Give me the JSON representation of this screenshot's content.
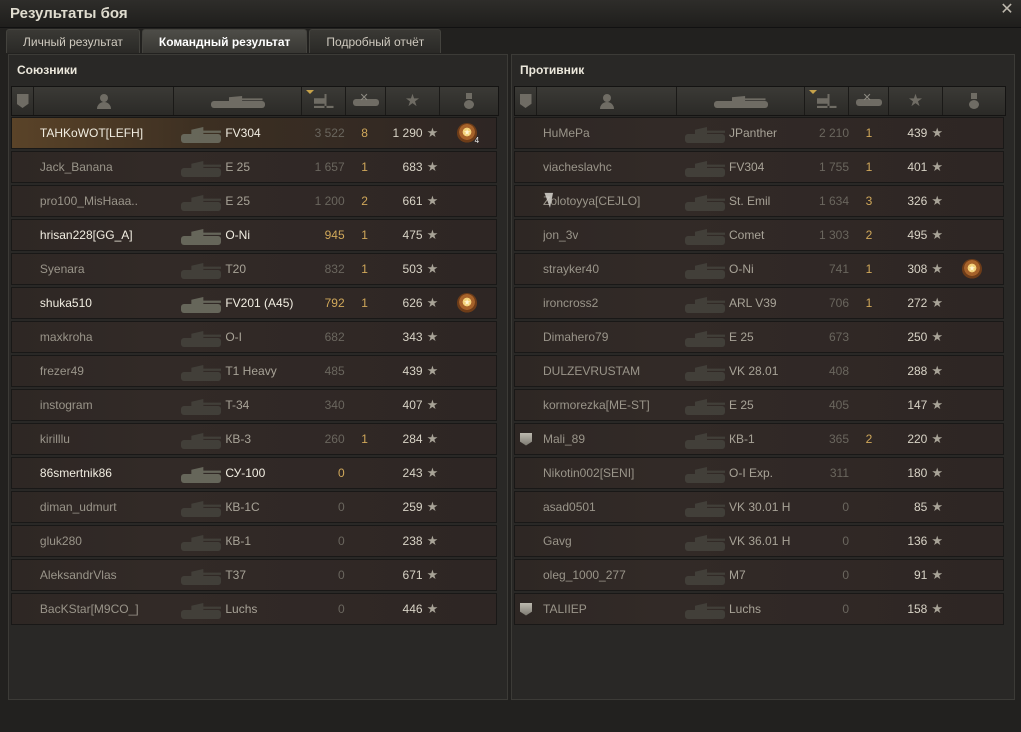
{
  "window": {
    "title": "Результаты боя",
    "close_icon": "close-icon"
  },
  "tabs": [
    {
      "label": "Личный результат",
      "active": false
    },
    {
      "label": "Командный результат",
      "active": true
    },
    {
      "label": "Подробный отчёт",
      "active": false
    }
  ],
  "allies": {
    "title": "Союзники",
    "columns": [
      "platoon-icon",
      "player-icon",
      "vehicle-icon",
      "damage-icon",
      "frags-icon",
      "xp-star-icon",
      "medal-icon"
    ],
    "sorted_column": "damage-icon",
    "rows": [
      {
        "name": "TAHKoWOT[LEFH]",
        "tank": "FV304",
        "damage": "3 522",
        "frags": "8",
        "xp": "1 290",
        "medal": true,
        "medal_count": "4",
        "self": true,
        "hi": true
      },
      {
        "name": "Jack_Banana",
        "tank": "E 25",
        "damage": "1 657",
        "frags": "1",
        "xp": "683"
      },
      {
        "name": "pro100_MisHaaa..",
        "tank": "E 25",
        "damage": "1 200",
        "frags": "2",
        "xp": "661"
      },
      {
        "name": "hrisan228[GG_A]",
        "tank": "O-Ni",
        "damage": "945",
        "frags": "1",
        "xp": "475",
        "hi": true,
        "gold": true
      },
      {
        "name": "Syenara",
        "tank": "T20",
        "damage": "832",
        "frags": "1",
        "xp": "503"
      },
      {
        "name": "shuka510",
        "tank": "FV201 (A45)",
        "damage": "792",
        "frags": "1",
        "xp": "626",
        "medal": true,
        "hi": true,
        "gold": true
      },
      {
        "name": "maxkroha",
        "tank": "O-I",
        "damage": "682",
        "frags": "",
        "xp": "343"
      },
      {
        "name": "frezer49",
        "tank": "T1 Heavy",
        "damage": "485",
        "frags": "",
        "xp": "439"
      },
      {
        "name": "instogram",
        "tank": "T-34",
        "damage": "340",
        "frags": "",
        "xp": "407"
      },
      {
        "name": "kirilllu",
        "tank": "КВ-3",
        "damage": "260",
        "frags": "1",
        "xp": "284"
      },
      {
        "name": "86smertnik86",
        "tank": "СУ-100",
        "damage": "0",
        "frags": "",
        "xp": "243",
        "hi": true,
        "gold": true
      },
      {
        "name": "diman_udmurt",
        "tank": "КВ-1С",
        "damage": "0",
        "frags": "",
        "xp": "259"
      },
      {
        "name": "gluk280",
        "tank": "КВ-1",
        "damage": "0",
        "frags": "",
        "xp": "238"
      },
      {
        "name": "AleksandrVlas",
        "tank": "T37",
        "damage": "0",
        "frags": "",
        "xp": "671"
      },
      {
        "name": "BacKStar[M9CO_]",
        "tank": "Luchs",
        "damage": "0",
        "frags": "",
        "xp": "446"
      }
    ]
  },
  "enemies": {
    "title": "Противник",
    "columns": [
      "platoon-icon",
      "player-icon",
      "vehicle-icon",
      "damage-icon",
      "frags-icon",
      "xp-star-icon",
      "medal-icon"
    ],
    "sorted_column": "damage-icon",
    "rows": [
      {
        "name": "HuMePa",
        "tank": "JPanther",
        "damage": "2 210",
        "frags": "1",
        "xp": "439"
      },
      {
        "name": "viacheslavhc",
        "tank": "FV304",
        "damage": "1 755",
        "frags": "1",
        "xp": "401"
      },
      {
        "name": "Zolotoyya[CEJLO]",
        "tank": "St. Emil",
        "damage": "1 634",
        "frags": "3",
        "xp": "326"
      },
      {
        "name": "jon_3v",
        "tank": "Comet",
        "damage": "1 303",
        "frags": "2",
        "xp": "495"
      },
      {
        "name": "strayker40",
        "tank": "O-Ni",
        "damage": "741",
        "frags": "1",
        "xp": "308",
        "medal": true
      },
      {
        "name": "ironcross2",
        "tank": "ARL V39",
        "damage": "706",
        "frags": "1",
        "xp": "272"
      },
      {
        "name": "Dimahero79",
        "tank": "E 25",
        "damage": "673",
        "frags": "",
        "xp": "250"
      },
      {
        "name": "DULZEVRUSTAM",
        "tank": "VK 28.01",
        "damage": "408",
        "frags": "",
        "xp": "288"
      },
      {
        "name": "kormorezka[ME-ST]",
        "tank": "E 25",
        "damage": "405",
        "frags": "",
        "xp": "147"
      },
      {
        "name": "Mali_89",
        "tank": "КВ-1",
        "damage": "365",
        "frags": "2",
        "xp": "220",
        "platoon": true
      },
      {
        "name": "Nikotin002[SENI]",
        "tank": "O-I Exp.",
        "damage": "311",
        "frags": "",
        "xp": "180"
      },
      {
        "name": "asad0501",
        "tank": "VK 30.01 H",
        "damage": "0",
        "frags": "",
        "xp": "85"
      },
      {
        "name": "Gavg",
        "tank": "VK 36.01 H",
        "damage": "0",
        "frags": "",
        "xp": "136"
      },
      {
        "name": "oleg_1000_277",
        "tank": "M7",
        "damage": "0",
        "frags": "",
        "xp": "91"
      },
      {
        "name": "TALIIEP",
        "tank": "Luchs",
        "damage": "0",
        "frags": "",
        "xp": "158",
        "platoon": true
      }
    ]
  },
  "colors": {
    "gold": "#d0a85a",
    "self_row": "#5a4328",
    "text": "#c9c4b8"
  }
}
